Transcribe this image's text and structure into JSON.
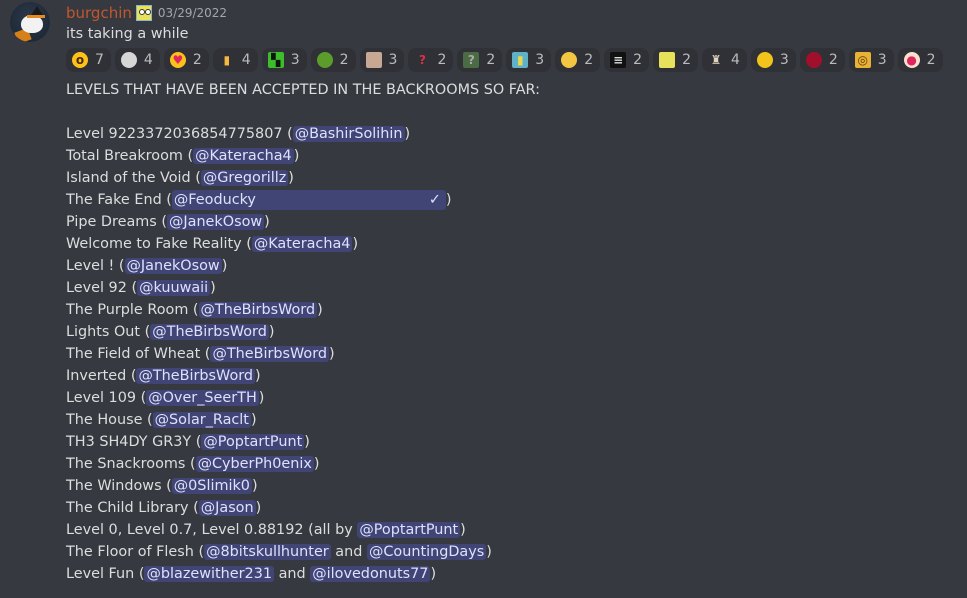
{
  "message": {
    "username": "burgchin",
    "username_color": "#c0582d",
    "role_icon": "spongebob-role-icon",
    "timestamp": "03/29/2022",
    "text": "its taking a while"
  },
  "reactions": [
    {
      "emoji": "hushed-face-emoji",
      "count": "7"
    },
    {
      "emoji": "skull-emoji",
      "count": "4"
    },
    {
      "emoji": "heart-eyes-emoji",
      "count": "2"
    },
    {
      "emoji": "middle-finger-emoji",
      "count": "4"
    },
    {
      "emoji": "green-pixel-custom-emoji",
      "count": "3"
    },
    {
      "emoji": "green-blob-custom-emoji",
      "count": "2"
    },
    {
      "emoji": "man-face-custom-emoji",
      "count": "3"
    },
    {
      "emoji": "red-question-mark-emoji",
      "count": "2"
    },
    {
      "emoji": "green-question-custom-emoji",
      "count": "2"
    },
    {
      "emoji": "yellow-sponge-custom-emoji",
      "count": "3"
    },
    {
      "emoji": "face-with-raised-eyebrow-emoji",
      "count": "2"
    },
    {
      "emoji": "black-text-custom-emoji",
      "count": "2"
    },
    {
      "emoji": "spongebob-custom-emoji",
      "count": "2"
    },
    {
      "emoji": "small-figure-custom-emoji",
      "count": "4"
    },
    {
      "emoji": "tongue-face-custom-emoji",
      "count": "3"
    },
    {
      "emoji": "red-gem-custom-emoji",
      "count": "2"
    },
    {
      "emoji": "nerd-face-custom-emoji",
      "count": "3"
    },
    {
      "emoji": "clown-face-emoji",
      "count": "2"
    }
  ],
  "body": {
    "heading": "LEVELS THAT HAVE BEEN ACCEPTED IN THE BACKROOMS SO FAR:",
    "levels": [
      {
        "name": "Level 9223372036854775807 (",
        "mentions": [
          "@BashirSolihin"
        ],
        "suffix": ")"
      },
      {
        "name": "Total Breakroom (",
        "mentions": [
          "@Kateracha4"
        ],
        "suffix": ")"
      },
      {
        "name": "Island of the Void (",
        "mentions": [
          "@Gregorillz"
        ],
        "suffix": ")"
      },
      {
        "name": "The Fake End (",
        "mentions": [
          "@Feoducky"
        ],
        "check": "✓",
        "suffix": ")"
      },
      {
        "name": "Pipe Dreams (",
        "mentions": [
          "@JanekOsow"
        ],
        "suffix": ")"
      },
      {
        "name": "Welcome to Fake Reality (",
        "mentions": [
          "@Kateracha4"
        ],
        "suffix": ")"
      },
      {
        "name": "Level ! (",
        "mentions": [
          "@JanekOsow"
        ],
        "suffix": ")"
      },
      {
        "name": "Level 92 (",
        "mentions": [
          "@kuuwaii"
        ],
        "suffix": ")"
      },
      {
        "name": "The Purple Room (",
        "mentions": [
          "@TheBirbsWord"
        ],
        "suffix": ")"
      },
      {
        "name": "Lights Out (",
        "mentions": [
          "@TheBirbsWord"
        ],
        "suffix": ")"
      },
      {
        "name": "The Field of Wheat (",
        "mentions": [
          "@TheBirbsWord"
        ],
        "suffix": ")"
      },
      {
        "name": "Inverted (",
        "mentions": [
          "@TheBirbsWord"
        ],
        "suffix": ")"
      },
      {
        "name": "Level 109 (",
        "mentions": [
          "@Over_SeerTH"
        ],
        "suffix": ")"
      },
      {
        "name": "The House (",
        "mentions": [
          "@Solar_Raclt"
        ],
        "suffix": ")"
      },
      {
        "name": "TH3 SH4DY GR3Y (",
        "mentions": [
          "@PoptartPunt"
        ],
        "suffix": ")"
      },
      {
        "name": "The Snackrooms (",
        "mentions": [
          "@CyberPh0enix"
        ],
        "suffix": ")"
      },
      {
        "name": "The Windows (",
        "mentions": [
          "@0Slimik0"
        ],
        "suffix": ")"
      },
      {
        "name": "The Child Library (",
        "mentions": [
          "@Jason"
        ],
        "suffix": ")"
      },
      {
        "name": "Level 0, Level 0.7, Level 0.88192 (all by ",
        "mentions": [
          "@PoptartPunt"
        ],
        "suffix": ")"
      },
      {
        "name": "The Floor of Flesh (",
        "mentions": [
          "@8bitskullhunter",
          "@CountingDays"
        ],
        "joiner": " and ",
        "suffix": ")"
      },
      {
        "name": "Level Fun (",
        "mentions": [
          "@blazewither231",
          "@ilovedonuts77"
        ],
        "joiner": " and ",
        "suffix": ")"
      }
    ]
  },
  "colors": {
    "background": "#36393f",
    "text": "#dcddde",
    "mention_bg": "rgba(88,101,242,0.3)",
    "mention_text": "#dee0fc",
    "reaction_bg": "#2f3136",
    "timestamp": "#a3a6aa"
  }
}
